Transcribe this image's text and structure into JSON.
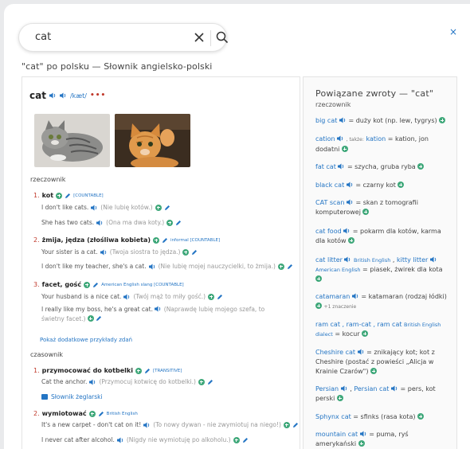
{
  "search": {
    "value": "cat",
    "clear_label": "✕"
  },
  "heading": "\"cat\" po polsku — Słownik angielsko-polski",
  "close_label": "×",
  "entry": {
    "headword": "cat",
    "ipa": "/kæt/",
    "more": "•••",
    "pos_noun": "rzeczownik",
    "pos_verb": "czasownik",
    "senses": [
      {
        "num": "1.",
        "word": "kot",
        "tag": "[COUNTABLE]",
        "examples": [
          {
            "en": "I don't like cats.",
            "pl": "(Nie lubię kotów.)"
          },
          {
            "en": "She has two cats.",
            "pl": "(Ona ma dwa koty.)"
          }
        ]
      },
      {
        "num": "2.",
        "word": "żmija, jędza (złośliwa kobieta)",
        "tag": "informal [COUNTABLE]",
        "examples": [
          {
            "en": "Your sister is a cat.",
            "pl": "(Twoja siostra to jędza.)"
          },
          {
            "en": "I don't like my teacher, she's a cat.",
            "pl": "(Nie lubię mojej nauczycielki, to żmija.)"
          }
        ]
      },
      {
        "num": "3.",
        "word": "facet, gość",
        "tag": "American English slang [COUNTABLE]",
        "examples": [
          {
            "en": "Your husband is a nice cat.",
            "pl": "(Twój mąż to miły gość.)"
          },
          {
            "en": "I really like my boss, he's a great cat.",
            "pl": "(Naprawdę lubię mojego szefa, to świetny facet.)"
          }
        ]
      }
    ],
    "more_examples": "Pokaż dodatkowe przykłady zdań",
    "verb_senses": [
      {
        "num": "1.",
        "word": "przymocować do kotbelki",
        "tag": "[TRANSITIVE]",
        "examples": [
          {
            "en": "Cat the anchor.",
            "pl": "(Przymocuj kotwicę do kotbelki.)"
          }
        ],
        "book": "Słownik żeglarski"
      },
      {
        "num": "2.",
        "word": "wymiotować",
        "tag": "British English",
        "examples": [
          {
            "en": "It's a new carpet - don't cat on it!",
            "pl": "(To nowy dywan - nie zwymiotuj na niego!)"
          },
          {
            "en": "I never cat after alcohol.",
            "pl": "(Nigdy nie wymiotuję po alkoholu.)"
          }
        ]
      }
    ]
  },
  "related": {
    "title": "Powiązane zwroty — \"cat\"",
    "subtitle": "rzeczownik",
    "items": [
      {
        "term": "big cat",
        "def": "= duży kot (np. lew, tygrys)"
      },
      {
        "term": "cation",
        "also_label": ", także:",
        "also": "kation",
        "def": "= kation, jon dodatni"
      },
      {
        "term": "fat cat",
        "def": "= szycha, gruba ryba"
      },
      {
        "term": "black cat",
        "def": "= czarny kot"
      },
      {
        "term": "CAT scan",
        "def": "= skan z tomografii komputerowej"
      },
      {
        "term": "cat food",
        "def": "= pokarm dla kotów, karma dla kotów"
      },
      {
        "term": "cat litter",
        "reg1": "British English",
        "sep": ",",
        "term2": "kitty litter",
        "reg2": "American English",
        "def": "= piasek, żwirek dla kota"
      },
      {
        "term": "catamaran",
        "def": "= katamaran (rodzaj łódki)",
        "extra": "+1 znaczenie"
      },
      {
        "term": "ram cat , ram-cat , ram cat",
        "reg1": "British English dialect",
        "def": "= kocur"
      },
      {
        "term": "Cheshire cat",
        "def": "= znikający kot; kot z Cheshire (postać z powieści „Alicja w Krainie Czarów\")"
      },
      {
        "term": "Persian",
        "sep": ",",
        "term2": "Persian cat",
        "def": "= pers, kot perski"
      },
      {
        "term": "Sphynx cat",
        "def": "= sfinks (rasa kota)"
      },
      {
        "term": "mountain cat",
        "def": "= puma, ryś amerykański"
      }
    ]
  },
  "colors": {
    "link": "#2475c4",
    "number": "#c0392b",
    "plus": "#3fa87a"
  },
  "images": [
    {
      "icon": "tabby-cat-photo"
    },
    {
      "icon": "orange-kitten-photo"
    }
  ]
}
